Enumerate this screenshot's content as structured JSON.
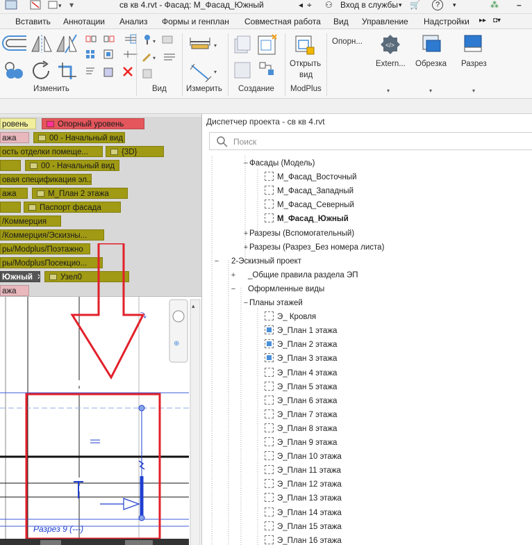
{
  "titlebar": {
    "window_title": "св кв 4.rvt - Фасад: М_Фасад_Южный",
    "signin": "Вход в службы"
  },
  "menu": {
    "tabs": [
      "Вставить",
      "Аннотации",
      "Анализ",
      "Формы и генплан",
      "Совместная работа",
      "Вид",
      "Управление",
      "Надстройки"
    ]
  },
  "ribbon": {
    "panel_modify": "Изменить",
    "panel_view": "Вид",
    "panel_measure": "Измерить",
    "panel_create": "Создание",
    "panel_modplus": "ModPlus",
    "open_view_line1": "Открыть",
    "open_view_line2": "вид",
    "ref_btn": "Опорн...",
    "extern_btn": "Extern...",
    "crop_btn": "Обрезка",
    "section_btn": "Разрез"
  },
  "view_tabs": [
    {
      "label": "ровень",
      "style": "yellow"
    },
    {
      "label": "Опорный уровень",
      "style": "red"
    },
    {
      "label": "ажа",
      "style": "pink"
    },
    {
      "label": "00 - Начальный вид",
      "style": "olive"
    },
    {
      "label": "ость отделки помеще...",
      "style": "olive"
    },
    {
      "label": "{3D}",
      "style": "olive"
    },
    {
      "label": "",
      "style": "olive"
    },
    {
      "label": "00 - Начальный вид",
      "style": "olive"
    },
    {
      "label": "овая спецификация эл...",
      "style": "olive"
    },
    {
      "label": "ажа",
      "style": "olive"
    },
    {
      "label": "М_План 2 этажа",
      "style": "olive"
    },
    {
      "label": "",
      "style": "olive"
    },
    {
      "label": "Паспорт фасада",
      "style": "olive"
    },
    {
      "label": "/Коммерция",
      "style": "olive"
    },
    {
      "label": "/Коммерция/Эскизны...",
      "style": "olive"
    },
    {
      "label": "ры/Modplus/Поэтажно",
      "style": "olive"
    },
    {
      "label": "ры/ModplusПосекцио...",
      "style": "olive"
    },
    {
      "label": "Южный",
      "style": "dark"
    },
    {
      "label": "Узел0",
      "style": "olive"
    },
    {
      "label": "ажа",
      "style": "pink"
    }
  ],
  "canvas": {
    "section_label": "Разрез 9 (---)"
  },
  "browser": {
    "title": "Диспетчер проекта - св кв 4.rvt",
    "search_placeholder": "Поиск",
    "nodes": [
      {
        "text": "Фасады (Модель)",
        "toggle": "−",
        "level": 2
      },
      {
        "text": "М_Фасад_Восточный",
        "level": 3,
        "icon": "view"
      },
      {
        "text": "М_Фасад_Западный",
        "level": 3,
        "icon": "view"
      },
      {
        "text": "М_Фасад_Северный",
        "level": 3,
        "icon": "view"
      },
      {
        "text": "М_Фасад_Южный",
        "level": 3,
        "icon": "view",
        "bold": true
      },
      {
        "text": "Разрезы (Вспомогательный)",
        "toggle": "+",
        "level": 2
      },
      {
        "text": "Разрезы (Разрез_Без номера листа)",
        "toggle": "+",
        "level": 2
      },
      {
        "text": "2-Эскизный проект",
        "toggle": "−",
        "level": 0
      },
      {
        "text": "_Общие правила раздела ЭП",
        "toggle": "+",
        "level": 1
      },
      {
        "text": "Оформленные виды",
        "toggle": "−",
        "level": 1
      },
      {
        "text": "Планы этажей",
        "toggle": "−",
        "level": 2
      },
      {
        "text": "Э_ Кровля",
        "level": 3,
        "icon": "view"
      },
      {
        "text": "Э_План 1 этажа",
        "level": 3,
        "icon": "blue"
      },
      {
        "text": "Э_План 2 этажа",
        "level": 3,
        "icon": "blue"
      },
      {
        "text": "Э_План 3 этажа",
        "level": 3,
        "icon": "blue"
      },
      {
        "text": "Э_План 4 этажа",
        "level": 3,
        "icon": "view"
      },
      {
        "text": "Э_План 5 этажа",
        "level": 3,
        "icon": "view"
      },
      {
        "text": "Э_План 6 этажа",
        "level": 3,
        "icon": "view"
      },
      {
        "text": "Э_План 7 этажа",
        "level": 3,
        "icon": "view"
      },
      {
        "text": "Э_План 8 этажа",
        "level": 3,
        "icon": "view"
      },
      {
        "text": "Э_План 9 этажа",
        "level": 3,
        "icon": "view"
      },
      {
        "text": "Э_План 10 этажа",
        "level": 3,
        "icon": "view"
      },
      {
        "text": "Э_План 11 этажа",
        "level": 3,
        "icon": "view"
      },
      {
        "text": "Э_План 12 этажа",
        "level": 3,
        "icon": "view"
      },
      {
        "text": "Э_План 13 этажа",
        "level": 3,
        "icon": "view"
      },
      {
        "text": "Э_План 14 этажа",
        "level": 3,
        "icon": "view"
      },
      {
        "text": "Э_План 15 этажа",
        "level": 3,
        "icon": "view"
      },
      {
        "text": "Э_План 16 этажа",
        "level": 3,
        "icon": "view"
      }
    ]
  },
  "colors": {
    "annotation_red": "#e2202a",
    "section_blue": "#1f3fd1",
    "tab_olive": "#a09a14"
  }
}
